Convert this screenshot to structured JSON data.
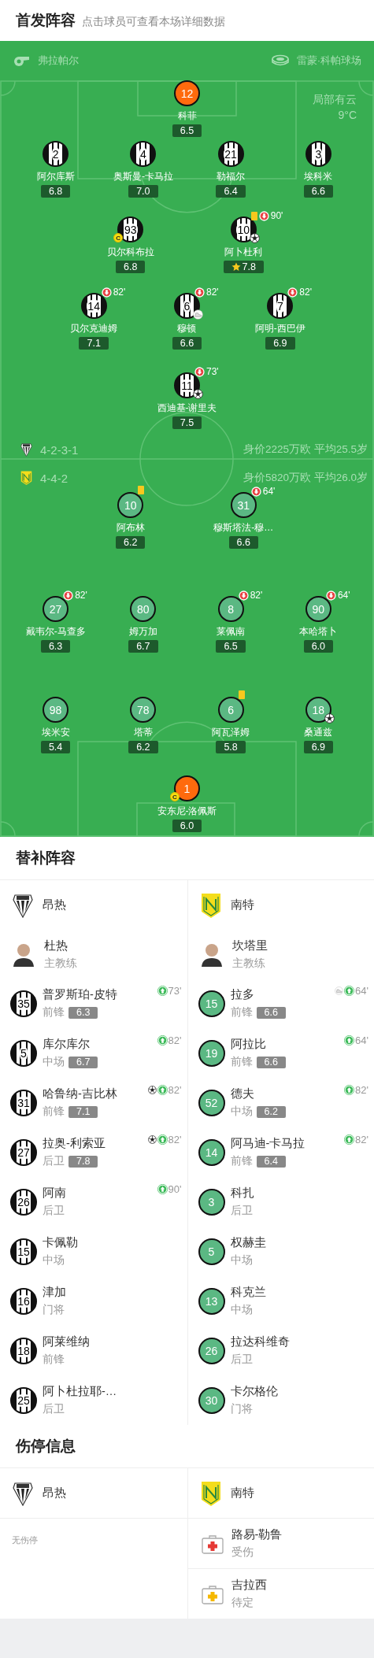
{
  "header": {
    "title": "首发阵容",
    "subtitle": "点击球员可查看本场详细数据"
  },
  "match": {
    "referee": "弗拉帕尔",
    "stadium": "雷蒙·科帕球场",
    "weather": "局部有云",
    "temperature": "9°C"
  },
  "lineups": [
    {
      "kind": "striped",
      "formation": "4-2-3-1",
      "value_info": "身价2225万欧 平均25.5岁",
      "lines": [
        [
          {
            "kind": "keeper",
            "number": "12",
            "name": "科菲",
            "rating": "6.5"
          }
        ],
        [
          {
            "kind": "outfield",
            "number": "2",
            "name": "阿尔库斯",
            "rating": "6.8"
          },
          {
            "kind": "outfield",
            "number": "4",
            "name": "奥斯曼-卡马拉",
            "rating": "7.0"
          },
          {
            "kind": "outfield",
            "number": "21",
            "name": "勒福尔",
            "rating": "6.4"
          },
          {
            "kind": "outfield",
            "number": "3",
            "name": "埃科米",
            "rating": "6.6"
          }
        ],
        [
          {
            "kind": "outfield",
            "number": "93",
            "name": "贝尔科布拉",
            "rating": "6.8",
            "events": [
              {
                "kind": "captain",
                "label": "C"
              }
            ]
          },
          {
            "kind": "outfield",
            "number": "10",
            "name": "阿卜杜利",
            "rating": "7.8",
            "events": [
              {
                "kind": "yellow_card"
              },
              {
                "kind": "sub_off",
                "minute": "90'"
              },
              {
                "kind": "goal"
              },
              {
                "kind": "best"
              }
            ]
          }
        ],
        [
          {
            "kind": "outfield",
            "number": "14",
            "name": "贝尔克迪姆",
            "rating": "7.1",
            "events": [
              {
                "kind": "sub_off",
                "minute": "82'"
              }
            ]
          },
          {
            "kind": "outfield",
            "number": "6",
            "name": "穆顿",
            "rating": "6.6",
            "events": [
              {
                "kind": "sub_off",
                "minute": "82'"
              },
              {
                "kind": "assist"
              }
            ]
          },
          {
            "kind": "outfield",
            "number": "7",
            "name": "阿明-西巴伊",
            "rating": "6.9",
            "events": [
              {
                "kind": "sub_off",
                "minute": "82'"
              }
            ]
          }
        ],
        [
          {
            "kind": "outfield",
            "number": "11",
            "name": "西迪基-谢里夫",
            "rating": "7.5",
            "events": [
              {
                "kind": "sub_off",
                "minute": "73'"
              },
              {
                "kind": "goal"
              }
            ]
          }
        ]
      ]
    },
    {
      "kind": "plain",
      "formation": "4-4-2",
      "value_info": "身价5820万欧 平均26.0岁",
      "lines": [
        [
          {
            "kind": "outfield",
            "number": "10",
            "name": "阿布林",
            "rating": "6.2",
            "events": [
              {
                "kind": "yellow_card"
              }
            ]
          },
          {
            "kind": "outfield",
            "number": "31",
            "name": "穆斯塔法-穆…",
            "rating": "6.6",
            "events": [
              {
                "kind": "sub_off",
                "minute": "64'"
              }
            ]
          }
        ],
        [
          {
            "kind": "outfield",
            "number": "27",
            "name": "戴韦尔-马查多",
            "rating": "6.3",
            "events": [
              {
                "kind": "sub_off",
                "minute": "82'"
              }
            ]
          },
          {
            "kind": "outfield",
            "number": "80",
            "name": "姆万加",
            "rating": "6.7"
          },
          {
            "kind": "outfield",
            "number": "8",
            "name": "莱佩南",
            "rating": "6.5",
            "events": [
              {
                "kind": "sub_off",
                "minute": "82'"
              }
            ]
          },
          {
            "kind": "outfield",
            "number": "90",
            "name": "本哈塔卜",
            "rating": "6.0",
            "events": [
              {
                "kind": "sub_off",
                "minute": "64'"
              }
            ]
          }
        ],
        [
          {
            "kind": "outfield",
            "number": "98",
            "name": "埃米安",
            "rating": "5.4"
          },
          {
            "kind": "outfield",
            "number": "78",
            "name": "塔蒂",
            "rating": "6.2"
          },
          {
            "kind": "outfield",
            "number": "6",
            "name": "阿瓦泽姆",
            "rating": "5.8",
            "events": [
              {
                "kind": "yellow_card"
              }
            ]
          },
          {
            "kind": "outfield",
            "number": "18",
            "name": "桑通兹",
            "rating": "6.9",
            "events": [
              {
                "kind": "goal"
              }
            ]
          }
        ],
        [
          {
            "kind": "keeper",
            "number": "1",
            "name": "安东尼-洛佩斯",
            "rating": "6.0",
            "events": [
              {
                "kind": "captain",
                "label": "C"
              }
            ]
          }
        ]
      ]
    }
  ],
  "substitutes": {
    "title": "替补阵容",
    "teams": [
      {
        "kind": "striped",
        "name": "昂热",
        "coach": {
          "name": "杜热",
          "role": "主教练"
        },
        "players": [
          {
            "number": "35",
            "name": "普罗斯珀-皮特",
            "position": "前锋",
            "rating": "6.3",
            "events": [
              {
                "kind": "sub_on",
                "minute": "73'"
              }
            ]
          },
          {
            "number": "5",
            "name": "库尔库尔",
            "position": "中场",
            "rating": "6.7",
            "events": [
              {
                "kind": "sub_on",
                "minute": "82'"
              }
            ]
          },
          {
            "number": "31",
            "name": "哈鲁纳-吉比林",
            "position": "前锋",
            "rating": "7.1",
            "events": [
              {
                "kind": "goal"
              },
              {
                "kind": "sub_on",
                "minute": "82'"
              }
            ]
          },
          {
            "number": "27",
            "name": "拉奥-利索亚",
            "position": "后卫",
            "rating": "7.8",
            "events": [
              {
                "kind": "goal"
              },
              {
                "kind": "sub_on",
                "minute": "82'"
              }
            ]
          },
          {
            "number": "26",
            "name": "阿南",
            "position": "后卫",
            "events": [
              {
                "kind": "sub_on",
                "minute": "90'"
              }
            ]
          },
          {
            "number": "15",
            "name": "卡佩勒",
            "position": "中场"
          },
          {
            "number": "16",
            "name": "津加",
            "position": "门将"
          },
          {
            "number": "18",
            "name": "阿莱维纳",
            "position": "前锋"
          },
          {
            "number": "25",
            "name": "阿卜杜拉耶-…",
            "position": "后卫"
          }
        ]
      },
      {
        "kind": "plain",
        "name": "南特",
        "coach": {
          "name": "坎塔里",
          "role": "主教练"
        },
        "players": [
          {
            "number": "15",
            "name": "拉多",
            "position": "前锋",
            "rating": "6.6",
            "events": [
              {
                "kind": "assist"
              },
              {
                "kind": "sub_on",
                "minute": "64'"
              }
            ]
          },
          {
            "number": "19",
            "name": "阿拉比",
            "position": "前锋",
            "rating": "6.6",
            "events": [
              {
                "kind": "sub_on",
                "minute": "64'"
              }
            ]
          },
          {
            "number": "52",
            "name": "德夫",
            "position": "中场",
            "rating": "6.2",
            "events": [
              {
                "kind": "sub_on",
                "minute": "82'"
              }
            ]
          },
          {
            "number": "14",
            "name": "阿马迪-卡马拉",
            "position": "前锋",
            "rating": "6.4",
            "events": [
              {
                "kind": "sub_on",
                "minute": "82'"
              }
            ]
          },
          {
            "number": "3",
            "name": "科扎",
            "position": "后卫"
          },
          {
            "number": "5",
            "name": "权赫圭",
            "position": "中场"
          },
          {
            "number": "13",
            "name": "科克兰",
            "position": "中场"
          },
          {
            "number": "26",
            "name": "拉达科维奇",
            "position": "后卫"
          },
          {
            "number": "30",
            "name": "卡尔格伦",
            "position": "门将"
          }
        ]
      }
    ]
  },
  "injuries": {
    "title": "伤停信息",
    "teams": [
      {
        "kind": "striped",
        "name": "昂热",
        "empty_text": "无伤停"
      },
      {
        "kind": "plain",
        "name": "南特",
        "players": [
          {
            "kind": "injured",
            "name": "路易-勒鲁",
            "status": "受伤"
          },
          {
            "kind": "doubtful",
            "name": "吉拉西",
            "status": "待定"
          }
        ]
      }
    ]
  }
}
